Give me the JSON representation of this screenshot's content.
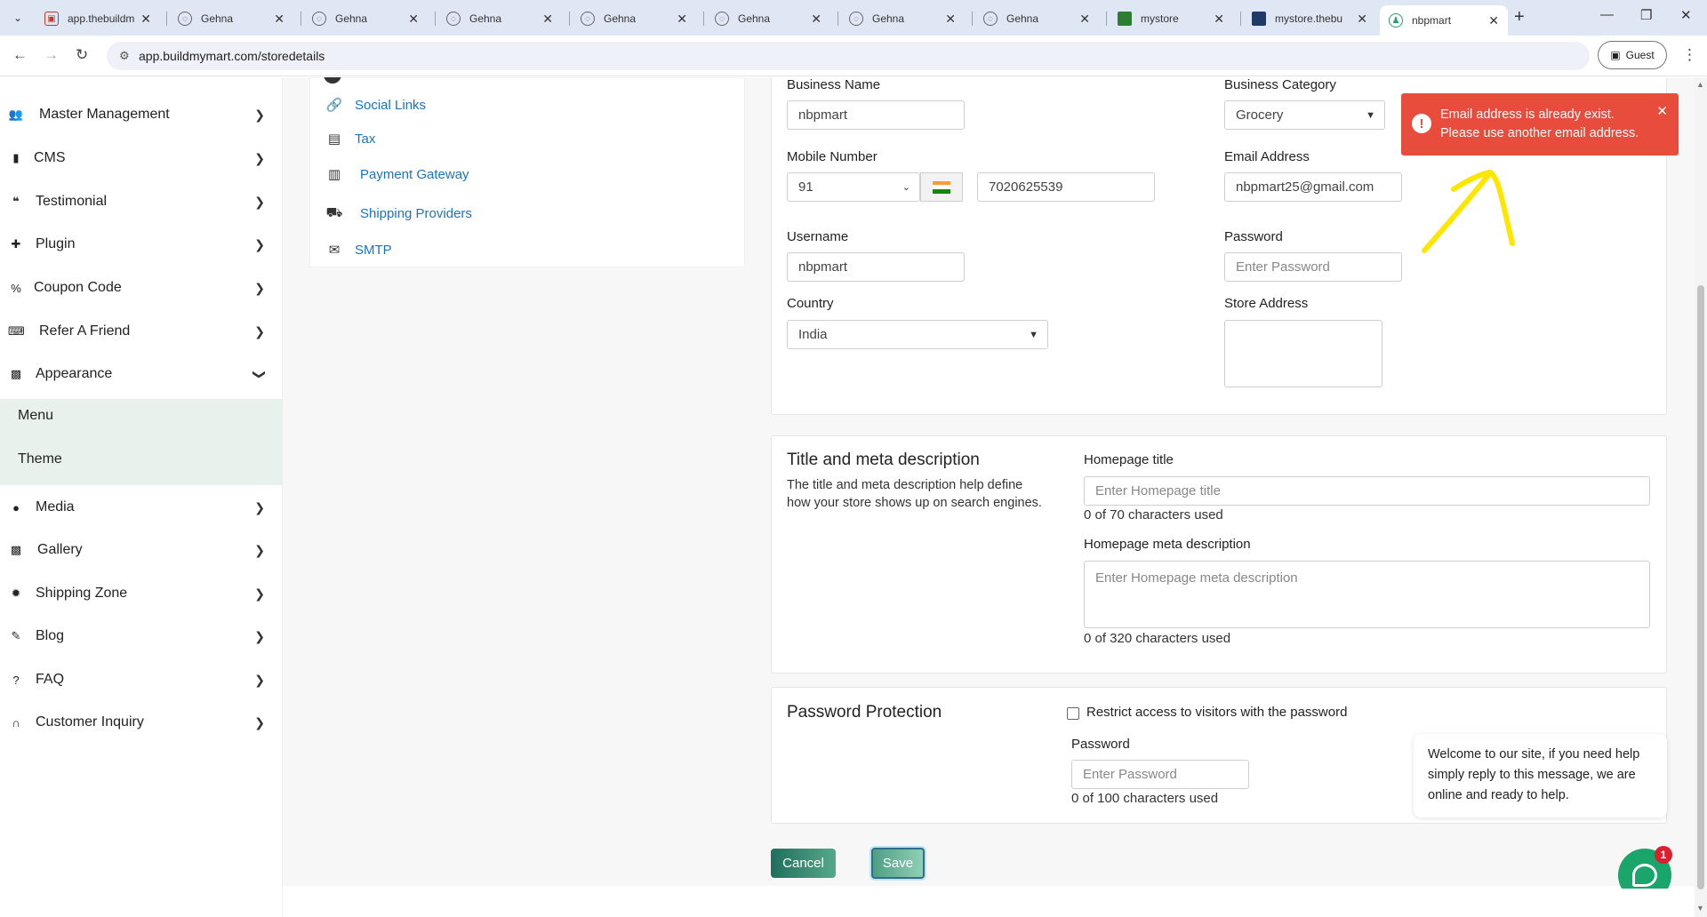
{
  "browser": {
    "tabs": [
      {
        "title": "app.thebuildm",
        "favicon": "gift-icon"
      },
      {
        "title": "Gehna",
        "favicon": "globe-icon"
      },
      {
        "title": "Gehna",
        "favicon": "globe-icon"
      },
      {
        "title": "Gehna",
        "favicon": "globe-icon"
      },
      {
        "title": "Gehna",
        "favicon": "globe-icon"
      },
      {
        "title": "Gehna",
        "favicon": "globe-icon"
      },
      {
        "title": "Gehna",
        "favicon": "globe-icon"
      },
      {
        "title": "Gehna",
        "favicon": "globe-icon"
      },
      {
        "title": "mystore",
        "favicon": "store-icon"
      },
      {
        "title": "mystore.thebu",
        "favicon": "store-icon"
      },
      {
        "title": "nbpmart",
        "favicon": "store-icon"
      }
    ],
    "url": "app.buildmymart.com/storedetails",
    "guest_label": "Guest"
  },
  "sidebar": {
    "items": [
      {
        "label": "Master Management",
        "icon": "users-cog-icon"
      },
      {
        "label": "CMS",
        "icon": "file-icon"
      },
      {
        "label": "Testimonial",
        "icon": "quote-icon"
      },
      {
        "label": "Plugin",
        "icon": "puzzle-icon"
      },
      {
        "label": "Coupon Code",
        "icon": "percent-icon"
      },
      {
        "label": "Refer A Friend",
        "icon": "keyboard-icon"
      },
      {
        "label": "Appearance",
        "icon": "image-icon"
      },
      {
        "label": "Media",
        "icon": "play-circle-icon"
      },
      {
        "label": "Gallery",
        "icon": "images-icon"
      },
      {
        "label": "Shipping Zone",
        "icon": "gear-icon"
      },
      {
        "label": "Blog",
        "icon": "pencil-icon"
      },
      {
        "label": "FAQ",
        "icon": "question-circle-icon"
      },
      {
        "label": "Customer Inquiry",
        "icon": "headset-icon"
      }
    ],
    "appearance_sub": [
      "Menu",
      "Theme"
    ]
  },
  "settings_nav": {
    "items": [
      {
        "label": "Social Links",
        "icon": "link-icon"
      },
      {
        "label": "Tax",
        "icon": "receipt-icon"
      },
      {
        "label": "Payment Gateway",
        "icon": "pos-terminal-icon"
      },
      {
        "label": "Shipping Providers",
        "icon": "truck-icon"
      },
      {
        "label": "SMTP",
        "icon": "mail-stack-icon"
      }
    ]
  },
  "store": {
    "business_name_label": "Business Name",
    "business_name": "nbpmart",
    "business_category_label": "Business Category",
    "business_category": "Grocery",
    "mobile_label": "Mobile Number",
    "mobile_code": "91",
    "mobile_number": "7020625539",
    "email_label": "Email Address",
    "email": "nbpmart25@gmail.com",
    "username_label": "Username",
    "username": "nbpmart",
    "password_label": "Password",
    "password_placeholder": "Enter Password",
    "country_label": "Country",
    "country": "India",
    "store_address_label": "Store Address"
  },
  "seo": {
    "title": "Title and meta description",
    "description": "The title and meta description help define how your store shows up on search engines.",
    "homepage_title_label": "Homepage title",
    "homepage_title_placeholder": "Enter Homepage title",
    "homepage_title_counter": "0 of 70 characters used",
    "meta_label": "Homepage meta description",
    "meta_placeholder": "Enter Homepage meta description",
    "meta_counter": "0 of 320 characters used"
  },
  "protection": {
    "title": "Password Protection",
    "checkbox_label": "Restrict access to visitors with the password",
    "password_label": "Password",
    "password_placeholder": "Enter Password",
    "counter": "0 of 100 characters used"
  },
  "actions": {
    "cancel": "Cancel",
    "save": "Save"
  },
  "toast": {
    "message": "Email address is already exist. Please use another email address."
  },
  "chat": {
    "message": "Welcome to our site, if you need help simply reply to this message, we are online and ready to help.",
    "badge": "1"
  },
  "colors": {
    "toast_bg": "#e74c3c",
    "link_blue": "#1a73c8",
    "save_green": "#4f9e86",
    "chat_green": "#1aa56b",
    "annotation_yellow": "#ffe600"
  }
}
